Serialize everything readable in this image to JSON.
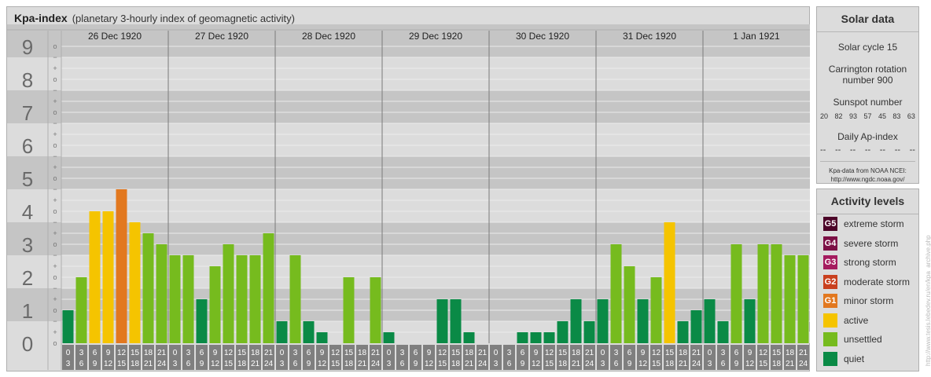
{
  "title": {
    "main": "Kpa-index",
    "subtitle": "(planetary 3-hourly index of geomagnetic activity)"
  },
  "chart_data": {
    "type": "bar",
    "title": "Kpa-index",
    "subtitle": "(planetary 3-hourly index of geomagnetic activity)",
    "ylim": [
      0,
      9
    ],
    "y_ticks": [
      "0",
      "1",
      "2",
      "3",
      "4",
      "5",
      "6",
      "7",
      "8",
      "9"
    ],
    "minor_tick_labels": [
      "o",
      "+",
      "−"
    ],
    "days": [
      "26 Dec 1920",
      "27 Dec 1920",
      "28 Dec 1920",
      "29 Dec 1920",
      "30 Dec 1920",
      "31 Dec 1920",
      "1 Jan 1921"
    ],
    "interval_labels": [
      [
        "0",
        "3"
      ],
      [
        "3",
        "6"
      ],
      [
        "6",
        "9"
      ],
      [
        "9",
        "12"
      ],
      [
        "12",
        "15"
      ],
      [
        "15",
        "18"
      ],
      [
        "18",
        "21"
      ],
      [
        "21",
        "24"
      ]
    ],
    "values": [
      [
        1.0,
        2.0,
        4.0,
        4.0,
        4.667,
        3.667,
        3.333,
        3.0
      ],
      [
        2.667,
        2.667,
        1.333,
        2.333,
        3.0,
        2.667,
        2.667,
        3.333
      ],
      [
        0.667,
        2.667,
        0.667,
        0.333,
        0.0,
        2.0,
        0.0,
        2.0
      ],
      [
        0.333,
        0.0,
        0.0,
        0.0,
        1.333,
        1.333,
        0.333,
        0.0
      ],
      [
        0.0,
        0.0,
        0.333,
        0.333,
        0.333,
        0.667,
        1.333,
        0.667
      ],
      [
        1.333,
        3.0,
        2.333,
        1.333,
        2.0,
        3.667,
        0.667,
        1.0
      ],
      [
        1.333,
        0.667,
        3.0,
        1.333,
        3.0,
        3.0,
        2.667,
        2.667
      ]
    ],
    "grid": true
  },
  "colors": {
    "quiet": "#0a8a46",
    "unsettled": "#76bb1e",
    "active": "#f5c400",
    "minor_storm": "#e2781f",
    "moderate_storm": "#c9401e",
    "strong_storm": "#a51b5e",
    "severe_storm": "#7c1045",
    "extreme_storm": "#4c0428",
    "band_dark": "#c5c5c5",
    "band_light": "#dcdcdc",
    "tick_box": "#7f7f7f"
  },
  "solar_panel": {
    "title": "Solar data",
    "solar_cycle": "Solar cycle 15",
    "carrington": "Carrington rotation number 900",
    "sunspot_title": "Sunspot number",
    "sunspot_values": [
      "20",
      "82",
      "93",
      "57",
      "45",
      "83",
      "63"
    ],
    "ap_title": "Daily Ap-index",
    "ap_values": [
      "--",
      "--",
      "--",
      "--",
      "--",
      "--",
      "--"
    ],
    "source_line1": "Kpa-data from NOAA NCEI:",
    "source_line2": "http://www.ngdc.noaa.gov/"
  },
  "activity_panel": {
    "title": "Activity levels",
    "levels": [
      {
        "badge": "G5",
        "label": "extreme storm",
        "color": "#4c0428"
      },
      {
        "badge": "G4",
        "label": "severe storm",
        "color": "#7c1045"
      },
      {
        "badge": "G3",
        "label": "strong storm",
        "color": "#a51b5e"
      },
      {
        "badge": "G2",
        "label": "moderate storm",
        "color": "#c9401e"
      },
      {
        "badge": "G1",
        "label": "minor storm",
        "color": "#e2781f"
      },
      {
        "badge": "",
        "label": "active",
        "color": "#f5c400"
      },
      {
        "badge": "",
        "label": "unsettled",
        "color": "#76bb1e"
      },
      {
        "badge": "",
        "label": "quiet",
        "color": "#0a8a46"
      }
    ]
  },
  "watermark": "http://www.tesis.lebedev.ru/en/kpa_archive.php"
}
